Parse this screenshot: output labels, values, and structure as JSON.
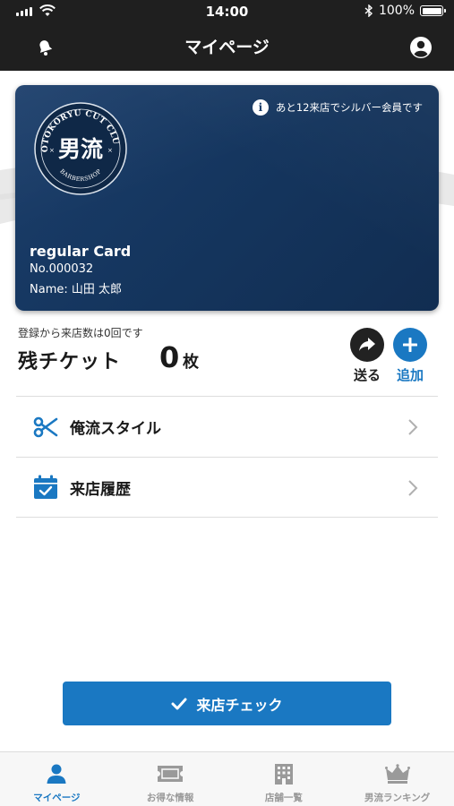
{
  "status_bar": {
    "time": "14:00",
    "battery": "100%"
  },
  "header": {
    "title": "マイページ",
    "left_icon": "bell-icon",
    "right_icon": "user-profile-icon"
  },
  "card": {
    "logo": {
      "top_text": "OTOKORYU CUT CLUB",
      "center_text": "男流",
      "bottom_text": "BARBERSHOP"
    },
    "notice": "あと12来店でシルバー会員です",
    "type": "regular Card",
    "number": "No.000032",
    "name": "Name: 山田 太郎",
    "color": "#16375f"
  },
  "tickets": {
    "visit_note": "登録から来店数は0回です",
    "label": "残チケット",
    "count": "0",
    "unit": "枚",
    "send_label": "送る",
    "add_label": "追加"
  },
  "menu": [
    {
      "label": "俺流スタイル",
      "icon": "scissors-icon"
    },
    {
      "label": "来店履歴",
      "icon": "calendar-check-icon"
    }
  ],
  "checkin_button": {
    "label": "来店チェック",
    "icon": "checkmark-icon"
  },
  "tabs": [
    {
      "label": "マイページ",
      "icon": "person-icon",
      "active": true
    },
    {
      "label": "お得な情報",
      "icon": "ticket-icon",
      "active": false
    },
    {
      "label": "店舗一覧",
      "icon": "building-icon",
      "active": false
    },
    {
      "label": "男流ランキング",
      "icon": "crown-icon",
      "active": false
    }
  ],
  "colors": {
    "accent": "#1a78c2",
    "header_bg": "#1f1f1f",
    "card_bg": "#16375f"
  }
}
